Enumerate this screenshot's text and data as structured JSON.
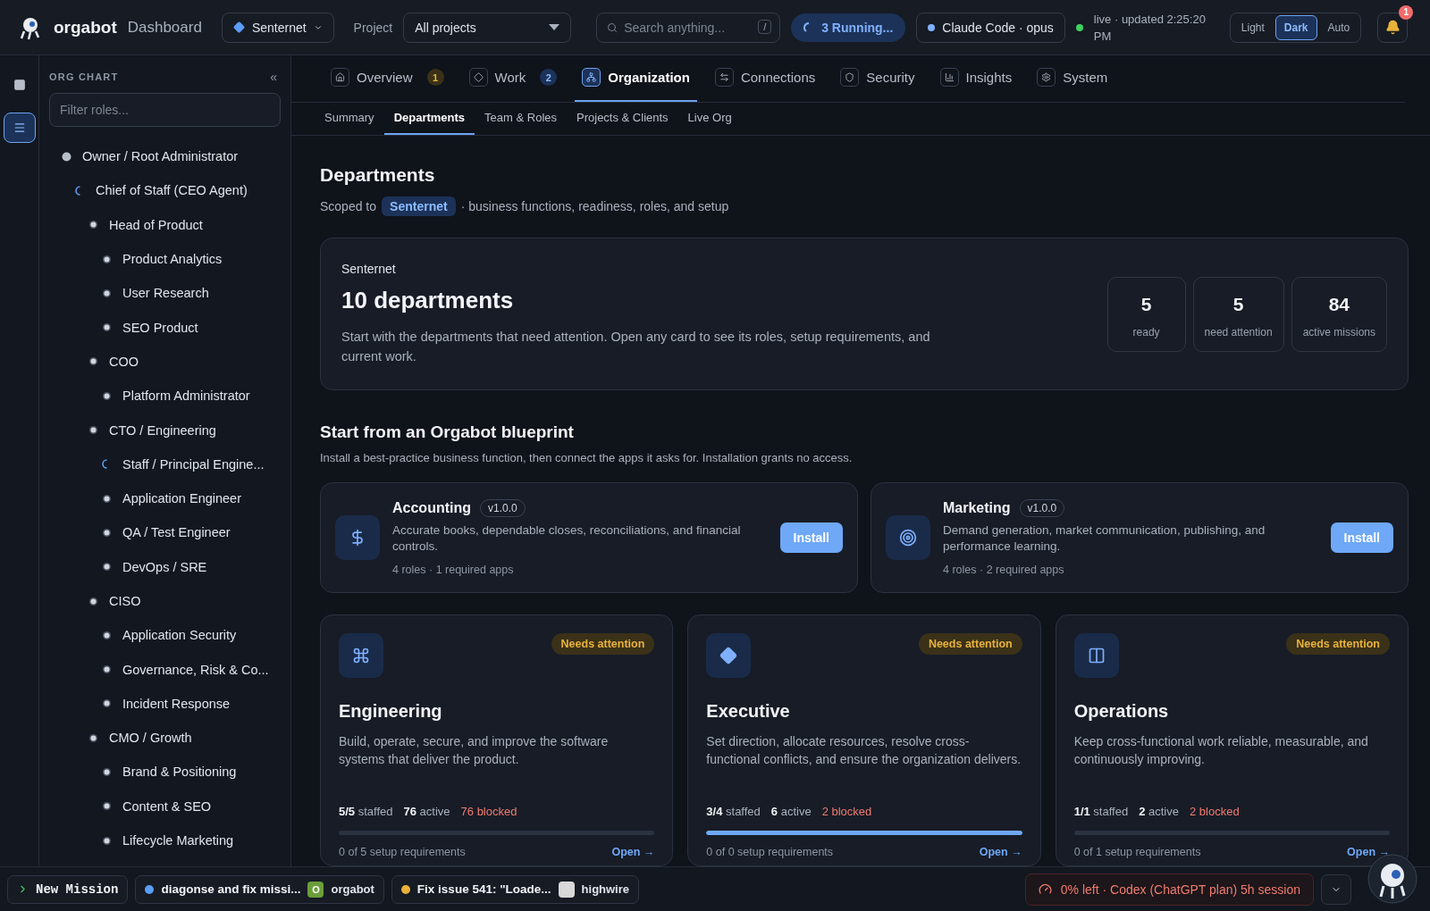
{
  "app": {
    "name": "orgabot",
    "section": "Dashboard"
  },
  "topbar": {
    "workspace": "Senternet",
    "project_label": "Project",
    "project": "All projects",
    "search": {
      "placeholder": "Search anything...",
      "shortcut": "/"
    },
    "running": "3 Running...",
    "agent": "Claude Code · opus",
    "live": "live · updated 2:25:20 PM",
    "themes": [
      {
        "label": "Light",
        "selected": false
      },
      {
        "label": "Dark",
        "selected": true
      },
      {
        "label": "Auto",
        "selected": false
      }
    ],
    "notifications": "1"
  },
  "sidebar": {
    "title": "ORG CHART",
    "collapse": "«",
    "filter": {
      "placeholder": "Filter roles..."
    },
    "tree": [
      {
        "label": "Owner / Root Administrator",
        "kind": "root",
        "children": [
          {
            "label": "Chief of Staff (CEO Agent)",
            "kind": "running",
            "children": [
              {
                "label": "Head of Product",
                "kind": "idle",
                "children": [
                  {
                    "label": "Product Analytics",
                    "kind": "idle"
                  },
                  {
                    "label": "User Research",
                    "kind": "idle"
                  },
                  {
                    "label": "SEO Product",
                    "kind": "idle"
                  }
                ]
              },
              {
                "label": "COO",
                "kind": "idle",
                "children": [
                  {
                    "label": "Platform Administrator",
                    "kind": "idle"
                  }
                ]
              },
              {
                "label": "CTO / Engineering",
                "kind": "idle",
                "children": [
                  {
                    "label": "Staff / Principal Engine...",
                    "kind": "running"
                  },
                  {
                    "label": "Application Engineer",
                    "kind": "idle"
                  },
                  {
                    "label": "QA / Test Engineer",
                    "kind": "idle"
                  },
                  {
                    "label": "DevOps / SRE",
                    "kind": "idle"
                  }
                ]
              },
              {
                "label": "CISO",
                "kind": "idle",
                "children": [
                  {
                    "label": "Application Security",
                    "kind": "idle"
                  },
                  {
                    "label": "Governance, Risk & Co...",
                    "kind": "idle"
                  },
                  {
                    "label": "Incident Response",
                    "kind": "idle"
                  }
                ]
              },
              {
                "label": "CMO / Growth",
                "kind": "idle",
                "children": [
                  {
                    "label": "Brand & Positioning",
                    "kind": "idle"
                  },
                  {
                    "label": "Content & SEO",
                    "kind": "idle"
                  },
                  {
                    "label": "Lifecycle Marketing",
                    "kind": "idle"
                  }
                ]
              }
            ]
          }
        ]
      }
    ]
  },
  "tabs": [
    {
      "label": "Overview",
      "badge": "1",
      "selected": false
    },
    {
      "label": "Work",
      "badge": "2",
      "selected": false
    },
    {
      "label": "Organization",
      "selected": true
    },
    {
      "label": "Connections",
      "selected": false
    },
    {
      "label": "Security",
      "selected": false
    },
    {
      "label": "Insights",
      "selected": false
    },
    {
      "label": "System",
      "selected": false
    }
  ],
  "subtabs": [
    {
      "label": "Summary",
      "selected": false
    },
    {
      "label": "Departments",
      "selected": true
    },
    {
      "label": "Team & Roles",
      "selected": false
    },
    {
      "label": "Projects & Clients",
      "selected": false
    },
    {
      "label": "Live Org",
      "selected": false
    }
  ],
  "page": {
    "title": "Departments",
    "scope_prefix": "Scoped to",
    "scope": "Senternet",
    "scope_suffix": "· business functions, readiness, roles, and setup"
  },
  "summary": {
    "org": "Senternet",
    "title": "10 departments",
    "text": "Start with the departments that need attention. Open any card to see its roles, setup requirements, and current work.",
    "stats": [
      {
        "value": "5",
        "label": "ready"
      },
      {
        "value": "5",
        "label": "need attention"
      },
      {
        "value": "84",
        "label": "active missions"
      }
    ]
  },
  "blueprints": {
    "title": "Start from an Orgabot blueprint",
    "text": "Install a best-practice business function, then connect the apps it asks for. Installation grants no access.",
    "items": [
      {
        "name": "Accounting",
        "version": "v1.0.0",
        "text": "Accurate books, dependable closes, reconciliations, and financial controls.",
        "meta": "4 roles · 1 required apps",
        "action": "Install"
      },
      {
        "name": "Marketing",
        "version": "v1.0.0",
        "text": "Demand generation, market communication, publishing, and performance learning.",
        "meta": "4 roles · 2 required apps",
        "action": "Install"
      }
    ]
  },
  "departments": [
    {
      "status": "Needs attention",
      "name": "Engineering",
      "text": "Build, operate, secure, and improve the software systems that deliver the product.",
      "staffed": "5/5",
      "staffed_label": "staffed",
      "active": "76",
      "active_label": "active",
      "blocked": "76 blocked",
      "level": 0,
      "setup": "0 of 5 setup requirements",
      "open": "Open →"
    },
    {
      "status": "Needs attention",
      "name": "Executive",
      "text": "Set direction, allocate resources, resolve cross-functional conflicts, and ensure the organization delivers.",
      "staffed": "3/4",
      "staffed_label": "staffed",
      "active": "6",
      "active_label": "active",
      "blocked": "2 blocked",
      "level": 1,
      "setup": "0 of 0 setup requirements",
      "open": "Open →"
    },
    {
      "status": "Needs attention",
      "name": "Operations",
      "text": "Keep cross-functional work reliable, measurable, and continuously improving.",
      "staffed": "1/1",
      "staffed_label": "staffed",
      "active": "2",
      "active_label": "active",
      "blocked": "2 blocked",
      "level": 0,
      "setup": "0 of 1 setup requirements",
      "open": "Open →"
    }
  ],
  "bottombar": {
    "new_mission": "New Mission",
    "missions": [
      {
        "title": "diagonse and fix missi...",
        "color": "#5b9df5",
        "project": "orgabot",
        "project_initial": "O"
      },
      {
        "title": "Fix issue 541: \"Loade...",
        "color": "#e8b23a",
        "project": "highwire"
      }
    ],
    "quota": "0% left · Codex (ChatGPT plan) 5h session"
  }
}
